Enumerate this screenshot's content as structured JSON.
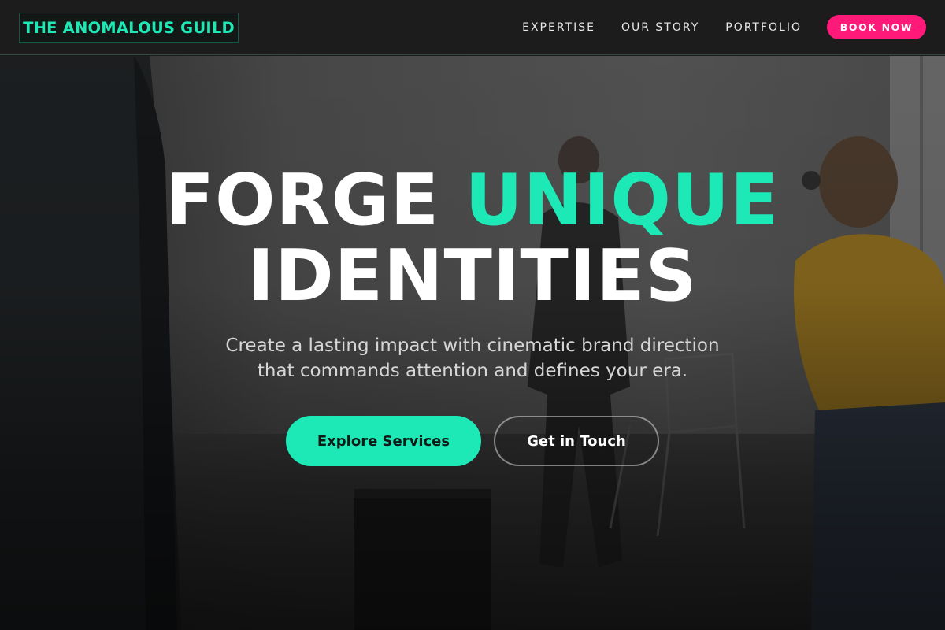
{
  "nav": {
    "logo": "THE ANOMALOUS GUILD",
    "links": [
      "EXPERTISE",
      "OUR STORY",
      "PORTFOLIO"
    ],
    "cta": "BOOK NOW"
  },
  "hero": {
    "headline_part1": "FORGE",
    "headline_accent": "UNIQUE",
    "headline_part2": "IDENTITIES",
    "subtext_line1": "Create a lasting impact with cinematic brand direction",
    "subtext_line2": "that commands attention and defines your era.",
    "primary_button": "Explore Services",
    "secondary_button": "Get in Touch"
  },
  "colors": {
    "accent": "#1de9b6",
    "cta_pink": "#ff1a7a",
    "nav_background": "#1c1c1c"
  }
}
